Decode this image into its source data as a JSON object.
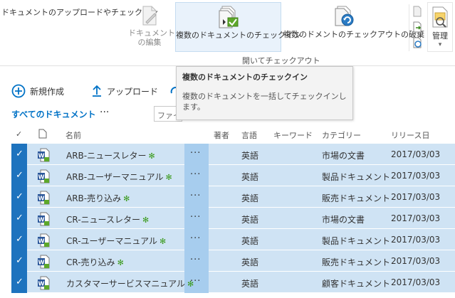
{
  "ribbon": {
    "tab_label": "ドキュメントのアップロードやチェックイン",
    "edit_label_line1": "ドキュメント",
    "edit_label_line2": "の編集",
    "checkin_multi_label": "複数のドキュメントのチェックイン",
    "discard_checkout_label": "複数のドメントのチェックアウトの破棄",
    "group_label": "開いてチェックアウト",
    "manage_label": "管理",
    "manage_arrow": "▾"
  },
  "tooltip": {
    "title": "複数のドキュメントのチェックイン",
    "body": "複数のドキュメントを一括してチェックインします。"
  },
  "commands": {
    "new_label": "新規作成",
    "upload_label": "アップロード"
  },
  "view": {
    "all_documents": "すべてのドキュメント",
    "more": "···",
    "search_placeholder": "ファイ"
  },
  "columns": {
    "check": "✓",
    "name": "名前",
    "author": "著者",
    "language": "言語",
    "keywords": "キーワード",
    "category": "カテゴリー",
    "release_date": "リリース日"
  },
  "rows": [
    {
      "name": "ARB-ニュースレター",
      "language": "英語",
      "category": "市場の文書",
      "date": "2017/03/03"
    },
    {
      "name": "ARB-ユーザーマニュアル",
      "language": "英語",
      "category": "製品ドキュメント",
      "date": "2017/03/03"
    },
    {
      "name": "ARB-売り込み",
      "language": "英語",
      "category": "販売ドキュメント",
      "date": "2017/03/03"
    },
    {
      "name": "CR-ニュースレター",
      "language": "英語",
      "category": "市場の文書",
      "date": "2017/03/03"
    },
    {
      "name": "CR-ユーザーマニュアル",
      "language": "英語",
      "category": "製品ドキュメント",
      "date": "2017/03/03"
    },
    {
      "name": "CR-売り込み",
      "language": "英語",
      "category": "販売ドキュメント",
      "date": "2017/03/03"
    },
    {
      "name": "カスタマーサービスマニュアル",
      "language": "英語",
      "category": "顧客ドキュメント",
      "date": "2017/03/03"
    }
  ],
  "row_new_marker": "✻",
  "row_check": "✓",
  "row_dots": "···",
  "colors": {
    "accent": "#0072c6",
    "selected_row": "#cfe3f4",
    "selection_bar": "#1e73be",
    "new_marker": "#3b9a1c"
  }
}
